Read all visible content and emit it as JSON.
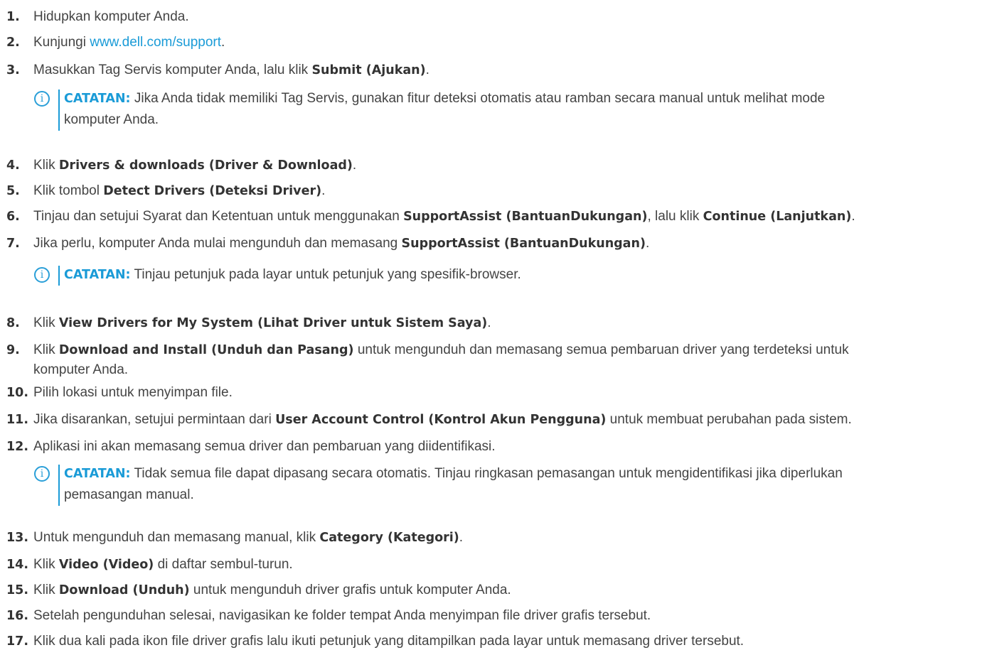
{
  "steps": [
    {
      "num": "1.",
      "text": "Hidupkan komputer Anda."
    },
    {
      "num": "2.",
      "pre": "Kunjungi ",
      "link": "www.dell.com/support",
      "post": "."
    },
    {
      "num": "3.",
      "pre": "Masukkan Tag Servis komputer Anda, lalu klik ",
      "bold": "Submit (Ajukan)",
      "post": "."
    },
    {
      "num": "4.",
      "pre": "Klik ",
      "bold": "Drivers & downloads (Driver & Download)",
      "post": "."
    },
    {
      "num": "5.",
      "pre": "Klik tombol ",
      "bold": "Detect Drivers (Deteksi Driver)",
      "post": "."
    },
    {
      "num": "6.",
      "pre": "Tinjau dan setujui Syarat dan Ketentuan untuk menggunakan ",
      "bold": "SupportAssist (BantuanDukungan)",
      "mid": ", lalu klik ",
      "bold2": "Continue (Lanjutkan)",
      "post": "."
    },
    {
      "num": "7.",
      "pre": "Jika perlu, komputer Anda mulai mengunduh dan memasang ",
      "bold": "SupportAssist (BantuanDukungan)",
      "post": "."
    },
    {
      "num": "8.",
      "pre": "Klik ",
      "bold": "View Drivers for My System (Lihat Driver untuk Sistem Saya)",
      "post": "."
    },
    {
      "num": "9.",
      "pre": "Klik ",
      "bold": "Download and Install (Unduh dan Pasang)",
      "post": " untuk mengunduh dan memasang semua pembaruan driver yang terdeteksi untuk",
      "cont": "komputer Anda."
    },
    {
      "num": "10.",
      "text": "Pilih lokasi untuk menyimpan file."
    },
    {
      "num": "11.",
      "pre": "Jika disarankan, setujui permintaan dari ",
      "bold": "User Account Control (Kontrol Akun Pengguna)",
      "post": " untuk membuat perubahan pada sistem."
    },
    {
      "num": "12.",
      "text": "Aplikasi ini akan memasang semua driver dan pembaruan yang diidentifikasi."
    },
    {
      "num": "13.",
      "pre": "Untuk mengunduh dan memasang manual, klik ",
      "bold": "Category (Kategori)",
      "post": "."
    },
    {
      "num": "14.",
      "pre": "Klik ",
      "bold": "Video (Video)",
      "post": " di daftar sembul-turun."
    },
    {
      "num": "15.",
      "pre": "Klik ",
      "bold": "Download (Unduh)",
      "post": " untuk mengunduh driver grafis untuk komputer Anda."
    },
    {
      "num": "16.",
      "text": "Setelah pengunduhan selesai, navigasikan ke folder tempat Anda menyimpan file driver grafis tersebut."
    },
    {
      "num": "17.",
      "text": "Klik dua kali pada ikon file driver grafis lalu ikuti petunjuk yang ditampilkan pada layar untuk memasang driver tersebut."
    }
  ],
  "notes": [
    {
      "label": "CATATAN:",
      "line1": " Jika Anda tidak memiliki Tag Servis, gunakan fitur deteksi otomatis atau ramban secara manual untuk melihat mode",
      "line2": "komputer Anda."
    },
    {
      "label": "CATATAN:",
      "line1": " Tinjau petunjuk pada layar untuk petunjuk yang spesifik-browser."
    },
    {
      "label": "CATATAN:",
      "line1": " Tidak semua file dapat dipasang secara otomatis. Tinjau ringkasan pemasangan untuk mengidentifikasi jika diperlukan",
      "line2": "pemasangan manual."
    }
  ],
  "icons": {
    "note": "info-circle-icon",
    "glyph": "i"
  },
  "colors": {
    "link": "#1a9bd7",
    "note_label": "#1a9bd7",
    "text": "#444444"
  }
}
